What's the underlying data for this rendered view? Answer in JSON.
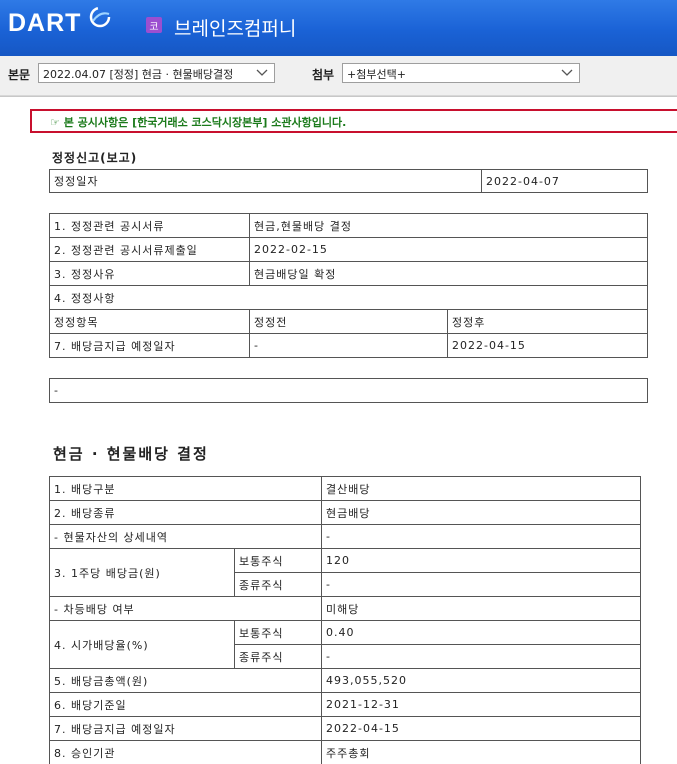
{
  "header": {
    "logo": "DART",
    "corp_badge": "코",
    "corp_name": "브레인즈컴퍼니"
  },
  "toolbar": {
    "body_label": "본문",
    "body_select": "2022.04.07  [정정] 현금 · 현물배당결정",
    "attach_label": "첨부",
    "attach_select": "+첨부선택+"
  },
  "notice": {
    "icon": "pointing-hand-icon",
    "text": "본 공시사항은 [한국거래소 코스닥시장본부] 소관사항입니다."
  },
  "correction": {
    "title": "정정신고(보고)",
    "date_label": "정정일자",
    "date_value": "2022-04-07",
    "rows": [
      {
        "label": "1. 정정관련 공시서류",
        "value": "현금,현물배당 결정"
      },
      {
        "label": "2. 정정관련 공시서류제출일",
        "value": "2022-02-15"
      },
      {
        "label": "3. 정정사유",
        "value": "현금배당일 확정"
      }
    ],
    "section4": "4. 정정사항",
    "headers": {
      "item": "정정항목",
      "before": "정정전",
      "after": "정정후"
    },
    "item_row": {
      "item": "7. 배당금지급 예정일자",
      "before": "-",
      "after": "2022-04-15"
    },
    "remark": "-"
  },
  "dividend": {
    "title": "현금 · 현물배당 결정",
    "r1": {
      "label": "1. 배당구분",
      "value": "결산배당"
    },
    "r2": {
      "label": "2. 배당종류",
      "value": "현금배당"
    },
    "r2a": {
      "label": "- 현물자산의 상세내역",
      "value": "-"
    },
    "r3": {
      "label": "3. 1주당 배당금(원)",
      "common": "보통주식",
      "common_value": "120",
      "pref": "종류주식",
      "pref_value": "-"
    },
    "r3a": {
      "label": "- 차등배당 여부",
      "value": "미해당"
    },
    "r4": {
      "label": "4. 시가배당율(%)",
      "common": "보통주식",
      "common_value": "0.40",
      "pref": "종류주식",
      "pref_value": "-"
    },
    "r5": {
      "label": "5. 배당금총액(원)",
      "value": "493,055,520"
    },
    "r6": {
      "label": "6. 배당기준일",
      "value": "2021-12-31"
    },
    "r7": {
      "label": "7. 배당금지급 예정일자",
      "value": "2022-04-15"
    },
    "r8": {
      "label": "8. 승인기관",
      "value": "주주총회"
    }
  }
}
